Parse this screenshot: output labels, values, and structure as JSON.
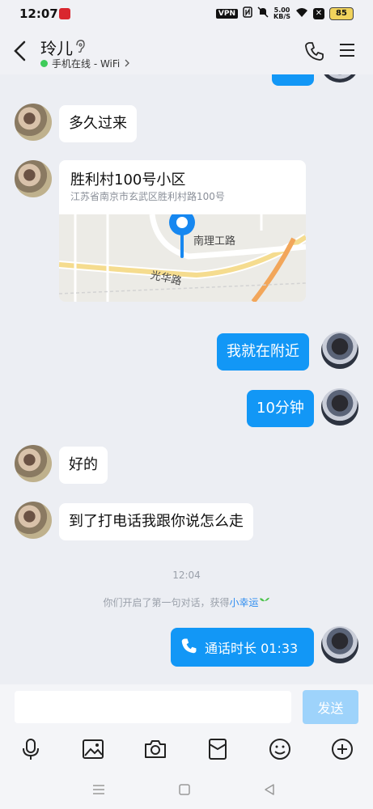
{
  "status_bar": {
    "time": "12:07",
    "vpn": "VPN",
    "speed_value": "5.00",
    "speed_unit": "KB/S",
    "battery": "85"
  },
  "header": {
    "title": "玲儿",
    "status": "手机在线 - WiFi",
    "status_color": "#3ecb5a"
  },
  "messages": [
    {
      "side": "in",
      "text": "多久过来"
    },
    {
      "side": "in",
      "type": "location",
      "title": "胜利村100号小区",
      "address": "江苏省南京市玄武区胜利村路100号",
      "map_labels": [
        "南理工路",
        "光华路"
      ]
    },
    {
      "side": "out",
      "text": "我就在附近"
    },
    {
      "side": "out",
      "text": "10分钟"
    },
    {
      "side": "in",
      "text": "好的"
    },
    {
      "side": "in",
      "text": "到了打电话我跟你说怎么走"
    }
  ],
  "system": {
    "time": "12:04",
    "note_prefix": "你们开启了第一句对话，获得",
    "note_link": "小幸运"
  },
  "call": {
    "text": "通话时长 01:33"
  },
  "input": {
    "placeholder": "",
    "send_label": "发送"
  },
  "toolbar_icons": [
    "microphone-icon",
    "image-icon",
    "camera-icon",
    "red-packet-icon",
    "emoji-icon",
    "plus-icon"
  ],
  "colors": {
    "accent": "#1297f6",
    "send_disabled": "#9ed3fb",
    "link": "#2d8cf0"
  }
}
